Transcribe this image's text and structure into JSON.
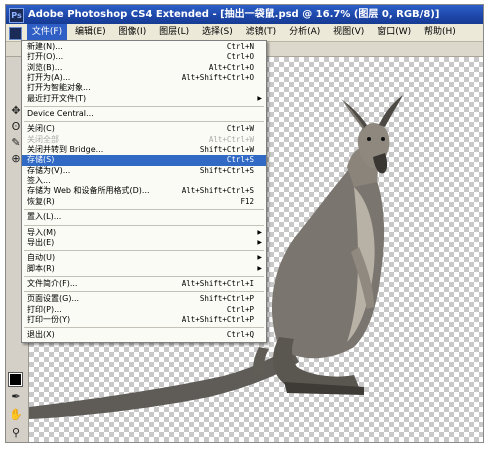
{
  "window": {
    "title": "Adobe Photoshop CS4 Extended - [抽出一袋鼠.psd @ 16.7% (图层 0, RGB/8)]"
  },
  "menubar": {
    "items": [
      {
        "label": "文件(F)"
      },
      {
        "label": "编辑(E)"
      },
      {
        "label": "图像(I)"
      },
      {
        "label": "图层(L)"
      },
      {
        "label": "选择(S)"
      },
      {
        "label": "滤镜(T)"
      },
      {
        "label": "分析(A)"
      },
      {
        "label": "视图(V)"
      },
      {
        "label": "窗口(W)"
      },
      {
        "label": "帮助(H)"
      }
    ],
    "toolbar_icons": "回回回 |亚田亚 |亚面亚 |"
  },
  "file_menu": {
    "items": [
      {
        "type": "item",
        "label": "新建(N)...",
        "shortcut": "Ctrl+N"
      },
      {
        "type": "item",
        "label": "打开(O)...",
        "shortcut": "Ctrl+O"
      },
      {
        "type": "item",
        "label": "浏览(B)...",
        "shortcut": "Alt+Ctrl+O"
      },
      {
        "type": "item",
        "label": "打开为(A)...",
        "shortcut": "Alt+Shift+Ctrl+O"
      },
      {
        "type": "item",
        "label": "打开为智能对象..."
      },
      {
        "type": "item",
        "label": "最近打开文件(T)",
        "submenu": true
      },
      {
        "type": "sep"
      },
      {
        "type": "item",
        "label": "Device Central..."
      },
      {
        "type": "sep"
      },
      {
        "type": "item",
        "label": "关闭(C)",
        "shortcut": "Ctrl+W"
      },
      {
        "type": "item",
        "label": "关闭全部",
        "shortcut": "Alt+Ctrl+W",
        "disabled": true
      },
      {
        "type": "item",
        "label": "关闭并转到 Bridge...",
        "shortcut": "Shift+Ctrl+W"
      },
      {
        "type": "item",
        "label": "存储(S)",
        "shortcut": "Ctrl+S",
        "highlight": true
      },
      {
        "type": "item",
        "label": "存储为(V)...",
        "shortcut": "Shift+Ctrl+S"
      },
      {
        "type": "item",
        "label": "签入..."
      },
      {
        "type": "item",
        "label": "存储为 Web 和设备所用格式(D)...",
        "shortcut": "Alt+Shift+Ctrl+S"
      },
      {
        "type": "item",
        "label": "恢复(R)",
        "shortcut": "F12"
      },
      {
        "type": "sep"
      },
      {
        "type": "item",
        "label": "置入(L)..."
      },
      {
        "type": "sep"
      },
      {
        "type": "item",
        "label": "导入(M)",
        "submenu": true
      },
      {
        "type": "item",
        "label": "导出(E)",
        "submenu": true
      },
      {
        "type": "sep"
      },
      {
        "type": "item",
        "label": "自动(U)",
        "submenu": true
      },
      {
        "type": "item",
        "label": "脚本(R)",
        "submenu": true
      },
      {
        "type": "sep"
      },
      {
        "type": "item",
        "label": "文件简介(F)...",
        "shortcut": "Alt+Shift+Ctrl+I"
      },
      {
        "type": "sep"
      },
      {
        "type": "item",
        "label": "页面设置(G)...",
        "shortcut": "Shift+Ctrl+P"
      },
      {
        "type": "item",
        "label": "打印(P)...",
        "shortcut": "Ctrl+P"
      },
      {
        "type": "item",
        "label": "打印一份(Y)",
        "shortcut": "Alt+Shift+Ctrl+P"
      },
      {
        "type": "sep"
      },
      {
        "type": "item",
        "label": "退出(X)",
        "shortcut": "Ctrl+Q"
      }
    ]
  },
  "toolbox": {
    "tools": [
      "move-tool",
      "lasso-tool",
      "brush-tool",
      "clone-tool",
      "eyedropper-tool",
      "hand-tool",
      "zoom-tool"
    ]
  },
  "colors": {
    "titlebar": "#1d46a8",
    "menu_highlight": "#316ac5"
  }
}
